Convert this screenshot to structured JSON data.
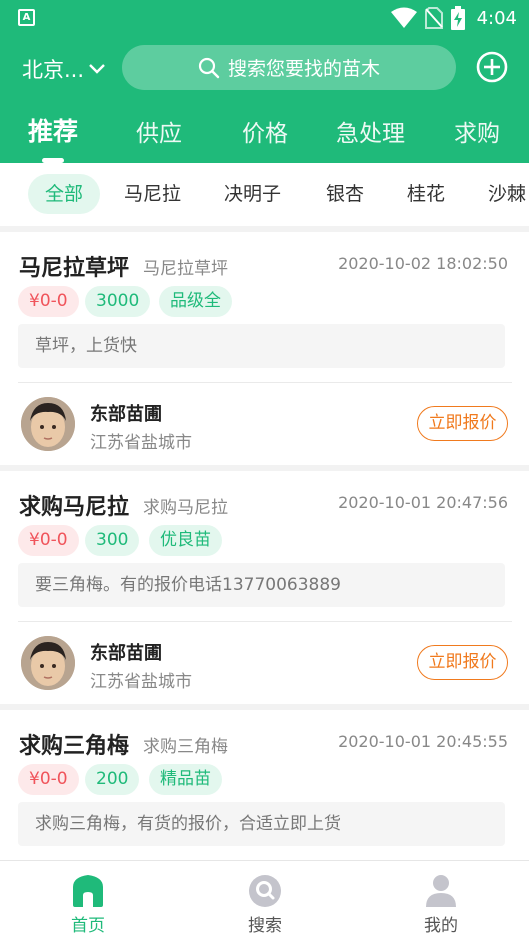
{
  "status_bar": {
    "app_icon_label": "A",
    "time": "4:04",
    "icons": [
      "wifi-icon",
      "no-sim-icon",
      "battery-charging-icon"
    ]
  },
  "header": {
    "city": "北京...",
    "search_placeholder": "搜索您要找的苗木",
    "add_icon": "plus-circle-icon",
    "colors": {
      "primary": "#1fba7a",
      "accent_orange": "#f07a1e",
      "price_red": "#f0545b"
    }
  },
  "tabs": [
    {
      "label": "推荐",
      "active": true
    },
    {
      "label": "供应",
      "active": false
    },
    {
      "label": "价格",
      "active": false
    },
    {
      "label": "急处理",
      "active": false
    },
    {
      "label": "求购",
      "active": false
    }
  ],
  "chips": [
    {
      "label": "全部",
      "active": true
    },
    {
      "label": "马尼拉",
      "active": false
    },
    {
      "label": "决明子",
      "active": false
    },
    {
      "label": "银杏",
      "active": false
    },
    {
      "label": "桂花",
      "active": false
    },
    {
      "label": "沙棘",
      "active": false
    }
  ],
  "listings": [
    {
      "title": "马尼拉草坪",
      "subtitle": "马尼拉草坪",
      "date": "2020-10-02 18:02:50",
      "price": "¥0-0",
      "quantity": "3000",
      "grade": "品级全",
      "description": "草坪，上货快",
      "seller": "东部苗圃",
      "location": "江苏省盐城市",
      "action": "立即报价"
    },
    {
      "title": "求购马尼拉",
      "subtitle": "求购马尼拉",
      "date": "2020-10-01 20:47:56",
      "price": "¥0-0",
      "quantity": "300",
      "grade": "优良苗",
      "description": "要三角梅。有的报价电话13770063889",
      "seller": "东部苗圃",
      "location": "江苏省盐城市",
      "action": "立即报价"
    },
    {
      "title": "求购三角梅",
      "subtitle": "求购三角梅",
      "date": "2020-10-01 20:45:55",
      "price": "¥0-0",
      "quantity": "200",
      "grade": "精品苗",
      "description": "求购三角梅，有货的报价，合适立即上货"
    }
  ],
  "bottom_nav": [
    {
      "label": "首页",
      "icon": "home-icon",
      "active": true
    },
    {
      "label": "搜索",
      "icon": "search-icon",
      "active": false
    },
    {
      "label": "我的",
      "icon": "profile-icon",
      "active": false
    }
  ]
}
